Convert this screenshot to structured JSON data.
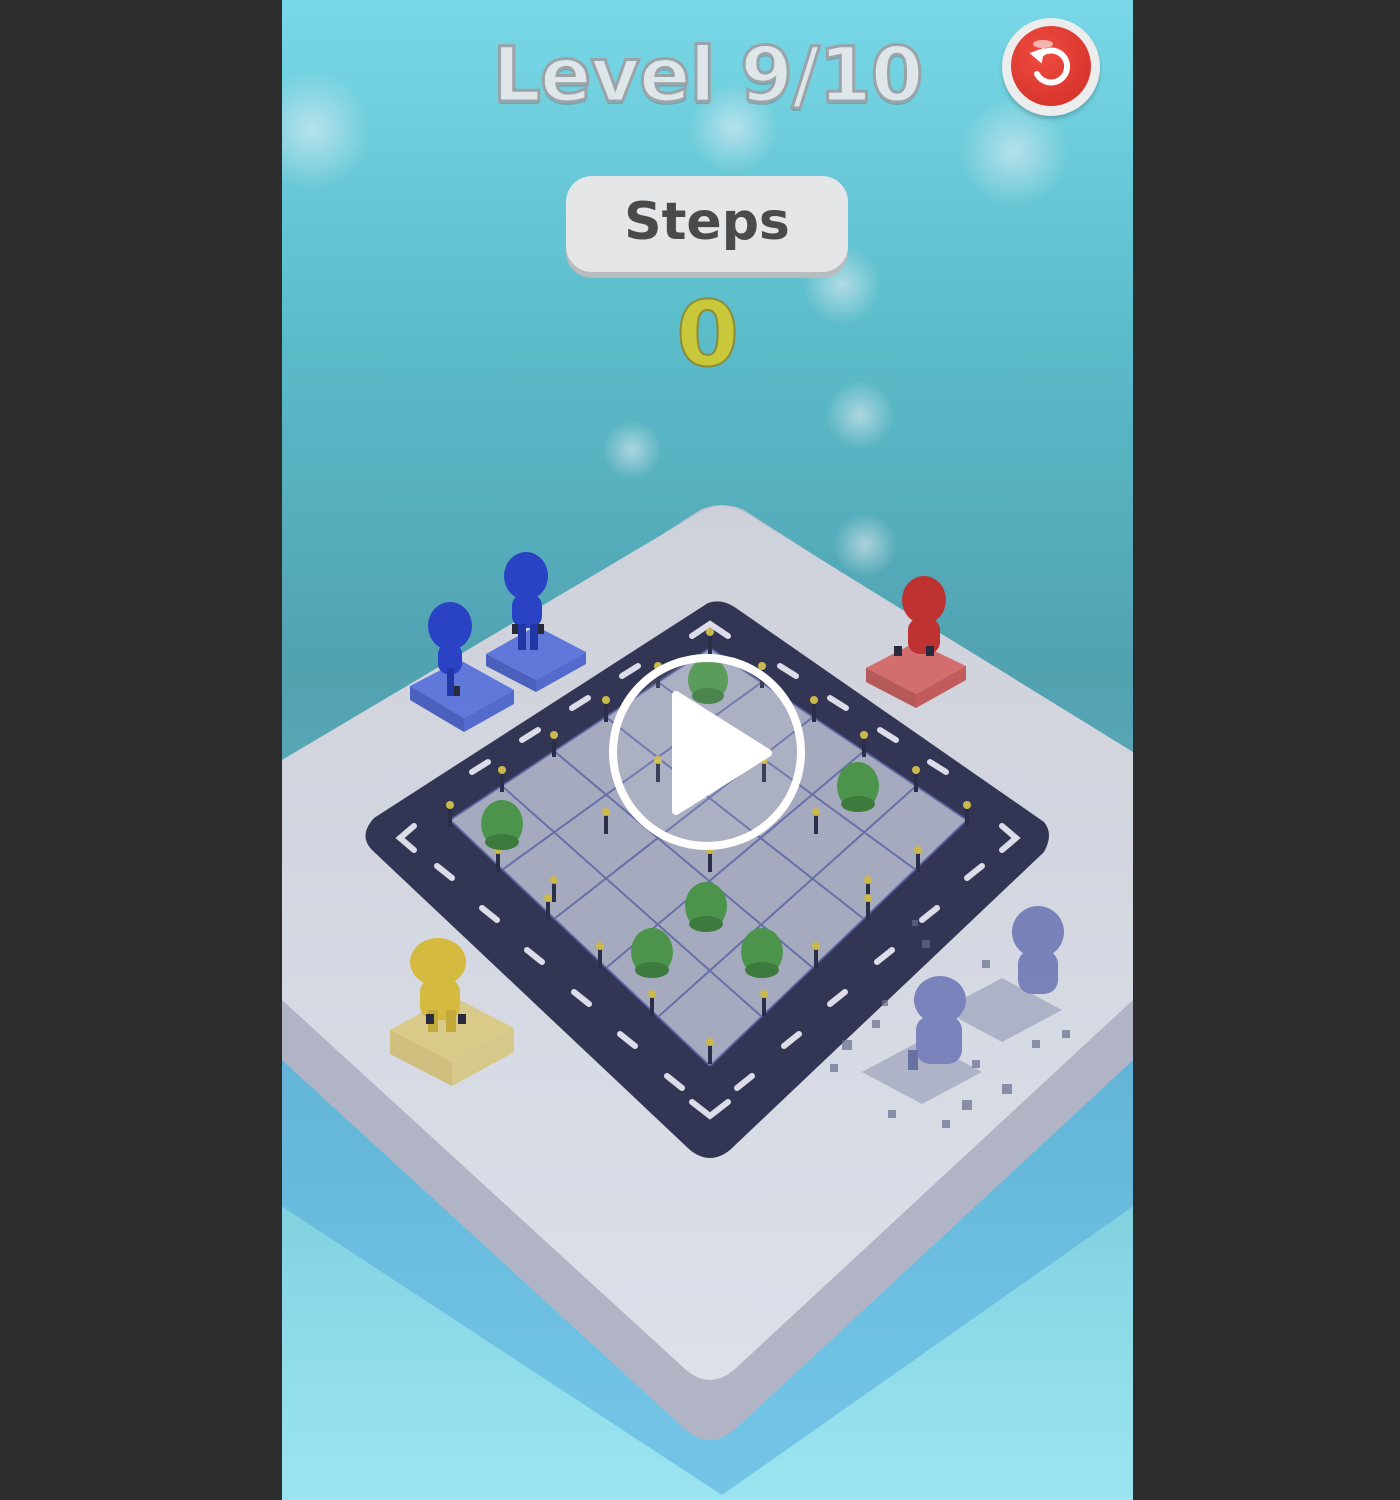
{
  "header": {
    "level_text": "Level 9/10",
    "restart_icon": "restart-icon"
  },
  "steps": {
    "label": "Steps",
    "count": "0"
  },
  "overlay": {
    "play_icon": "play-icon"
  },
  "colors": {
    "background_top": "#7fe3ee",
    "platform": "#dfe2e6",
    "road": "#3a3c52",
    "blue_character": "#2b43c8",
    "red_character": "#c8332c",
    "yellow_character": "#e0c33b",
    "tree": "#4f9b48",
    "restart_button": "#d9372e",
    "steps_count": "#c8c83a"
  }
}
